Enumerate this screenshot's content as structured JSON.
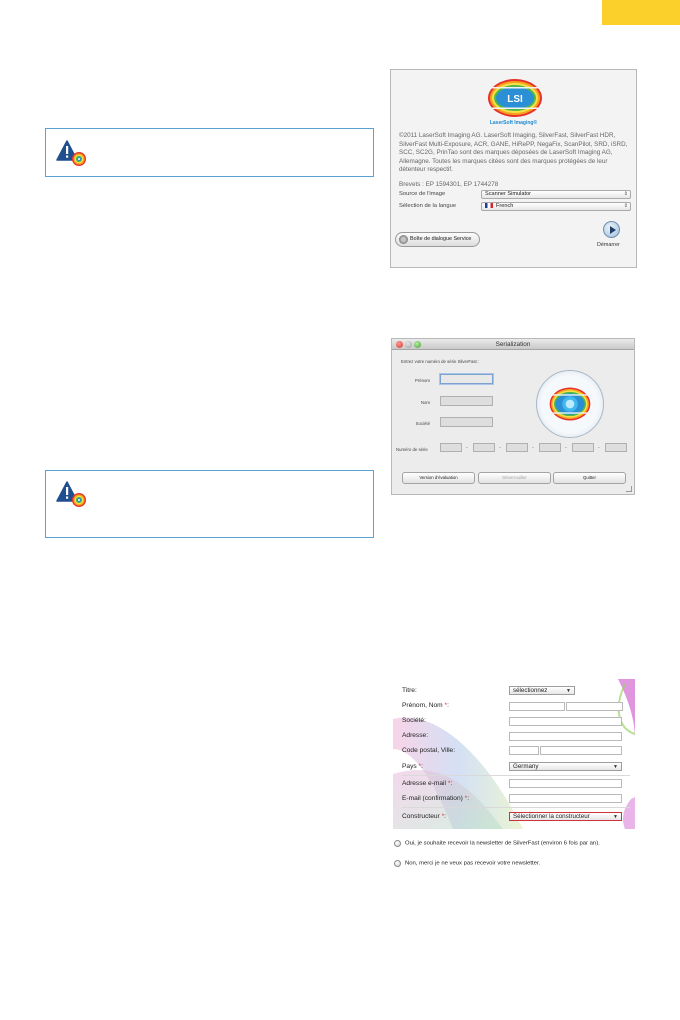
{
  "colors": {
    "corner_tab": "#fbd02b",
    "warning_border": "#5ba2d4",
    "brand_blue": "#1f8ad0",
    "required": "#d0313f"
  },
  "notes": [
    {
      "icon": "warning-icon"
    },
    {
      "icon": "warning-icon"
    }
  ],
  "launch_dialog": {
    "logo_text": "LSI",
    "brand": "LaserSoft Imaging®",
    "copyright": "©2011 LaserSoft Imaging AG. LaserSoft Imaging, SilverFast, SilverFast HDR, SilverFast Multi-Exposure, ACR, GANE, HiRePP, NegaFix, ScanPilot, SRD, iSRD, SCC, SC2G, PrinTao sont des marques déposées de LaserSoft Imaging AG, Allemagne. Toutes les marques citées sont des marques protégées de leur détenteur respectif.",
    "patents": "Brevets : EP 1594301, EP 1744278",
    "source_label": "Source de l'image",
    "source_value": "Scanner Simulator",
    "language_label": "Sélection de la langue",
    "language_value": "French",
    "service_button": "Boîte de dialogue Service",
    "start_label": "Démarrer"
  },
  "serialization": {
    "title": "Serialization",
    "intro": "Entrez votre numéro de série SilverFast :",
    "first_name_label": "Prénom",
    "last_name_label": "Nom",
    "company_label": "Société",
    "serial_label": "Numéro de série",
    "serial_separator": "-",
    "eval_button": "Version d'évaluation",
    "unlock_button": "Déverrouiller",
    "quit_button": "Quitter"
  },
  "registration": {
    "title_label": "Titre:",
    "title_select": "sélectionnez",
    "name_label": "Prénom, Nom ",
    "company_label": "Société:",
    "address_label": "Adresse:",
    "postal_label": "Code postal, Ville:",
    "country_label": "Pays ",
    "country_value": "Germany",
    "email_label": "Adresse e-mail ",
    "email_confirm_label": "E-mail (confirmation) ",
    "maker_label": "Constructeur ",
    "maker_value": "Sélectionner la constructeur",
    "required_mark": "*",
    "colon": ":"
  },
  "newsletter": {
    "yes": "Oui, je souhaite recevoir la newsletter de SilverFast (environ 6 fois par an).",
    "no": "Non, merci je ne veux pas recevoir votre newsletter."
  }
}
